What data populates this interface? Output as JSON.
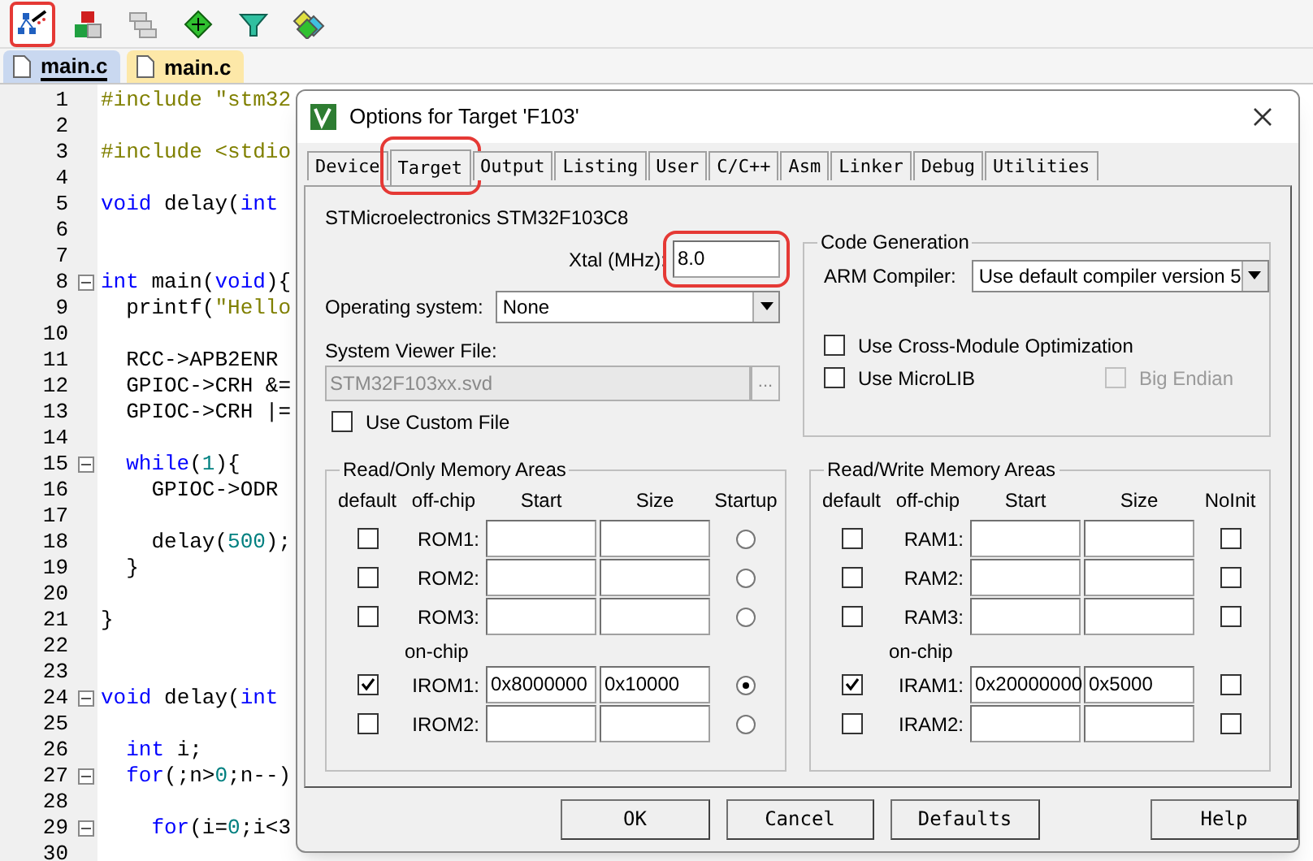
{
  "toolbar": [
    {
      "kind": "wand",
      "highlighted": true
    },
    {
      "kind": "blocks",
      "highlighted": false
    },
    {
      "kind": "windows",
      "highlighted": false
    },
    {
      "kind": "diamond",
      "highlighted": false
    },
    {
      "kind": "funnel",
      "highlighted": false
    },
    {
      "kind": "diamonds",
      "highlighted": false
    }
  ],
  "file_tabs": [
    {
      "label": "main.c",
      "selected": true
    },
    {
      "label": "main.c",
      "selected": false
    }
  ],
  "editor_lines": [
    {
      "number": "1",
      "fold": false,
      "tokens": [
        {
          "text": "#include \"stm32",
          "kind": "pre"
        }
      ]
    },
    {
      "number": "2",
      "fold": false
    },
    {
      "number": "3",
      "fold": false,
      "tokens": [
        {
          "text": "#include <stdio",
          "kind": "pre"
        }
      ]
    },
    {
      "number": "4",
      "fold": false
    },
    {
      "number": "5",
      "fold": false,
      "tokens": [
        {
          "text": "void",
          "kind": "kw"
        },
        {
          "text": " delay(",
          "kind": "plain"
        },
        {
          "text": "int",
          "kind": "kw"
        }
      ]
    },
    {
      "number": "6",
      "fold": false
    },
    {
      "number": "7",
      "fold": false
    },
    {
      "number": "8",
      "fold": true,
      "tokens": [
        {
          "text": "int",
          "kind": "kw"
        },
        {
          "text": " main(",
          "kind": "plain"
        },
        {
          "text": "void",
          "kind": "kw"
        },
        {
          "text": "){",
          "kind": "plain"
        }
      ]
    },
    {
      "number": "9",
      "fold": false,
      "tokens": [
        {
          "text": "  printf(",
          "kind": "plain"
        },
        {
          "text": "\"Hello",
          "kind": "str"
        }
      ]
    },
    {
      "number": "10",
      "fold": false
    },
    {
      "number": "11",
      "fold": false,
      "tokens": [
        {
          "text": "  RCC->APB2ENR",
          "kind": "plain"
        }
      ]
    },
    {
      "number": "12",
      "fold": false,
      "tokens": [
        {
          "text": "  GPIOC->CRH &=",
          "kind": "plain"
        }
      ]
    },
    {
      "number": "13",
      "fold": false,
      "tokens": [
        {
          "text": "  GPIOC->CRH |=",
          "kind": "plain"
        }
      ]
    },
    {
      "number": "14",
      "fold": false
    },
    {
      "number": "15",
      "fold": true,
      "tokens": [
        {
          "text": "  while",
          "kind": "kw"
        },
        {
          "text": "(",
          "kind": "plain"
        },
        {
          "text": "1",
          "kind": "num"
        },
        {
          "text": "){",
          "kind": "plain"
        }
      ]
    },
    {
      "number": "16",
      "fold": false,
      "tokens": [
        {
          "text": "    GPIOC->ODR",
          "kind": "plain"
        }
      ]
    },
    {
      "number": "17",
      "fold": false
    },
    {
      "number": "18",
      "fold": false,
      "tokens": [
        {
          "text": "    delay(",
          "kind": "plain"
        },
        {
          "text": "500",
          "kind": "num"
        },
        {
          "text": ");",
          "kind": "plain"
        }
      ]
    },
    {
      "number": "19",
      "fold": false,
      "tokens": [
        {
          "text": "  }",
          "kind": "plain"
        }
      ]
    },
    {
      "number": "20",
      "fold": false
    },
    {
      "number": "21",
      "fold": false,
      "tokens": [
        {
          "text": "}",
          "kind": "plain"
        }
      ]
    },
    {
      "number": "22",
      "fold": false
    },
    {
      "number": "23",
      "fold": false
    },
    {
      "number": "24",
      "fold": true,
      "tokens": [
        {
          "text": "void",
          "kind": "kw"
        },
        {
          "text": " delay(",
          "kind": "plain"
        },
        {
          "text": "int",
          "kind": "kw"
        }
      ]
    },
    {
      "number": "25",
      "fold": false
    },
    {
      "number": "26",
      "fold": false,
      "tokens": [
        {
          "text": "  int",
          "kind": "kw"
        },
        {
          "text": " i;",
          "kind": "plain"
        }
      ]
    },
    {
      "number": "27",
      "fold": true,
      "tokens": [
        {
          "text": "  for",
          "kind": "kw"
        },
        {
          "text": "(;n>",
          "kind": "plain"
        },
        {
          "text": "0",
          "kind": "num"
        },
        {
          "text": ";n--)",
          "kind": "plain"
        }
      ]
    },
    {
      "number": "28",
      "fold": false
    },
    {
      "number": "29",
      "fold": true,
      "tokens": [
        {
          "text": "    for",
          "kind": "kw"
        },
        {
          "text": "(i=",
          "kind": "plain"
        },
        {
          "text": "0",
          "kind": "num"
        },
        {
          "text": ";i<3",
          "kind": "plain"
        }
      ]
    },
    {
      "number": "30",
      "fold": false
    }
  ],
  "dialog": {
    "title": "Options for Target 'F103'",
    "tabs": [
      {
        "label": "Device",
        "selected": false,
        "highlighted": false
      },
      {
        "label": "Target",
        "selected": true,
        "highlighted": true
      },
      {
        "label": "Output",
        "selected": false,
        "highlighted": false
      },
      {
        "label": "Listing",
        "selected": false,
        "highlighted": false
      },
      {
        "label": "User",
        "selected": false,
        "highlighted": false
      },
      {
        "label": "C/C++",
        "selected": false,
        "highlighted": false
      },
      {
        "label": "Asm",
        "selected": false,
        "highlighted": false
      },
      {
        "label": "Linker",
        "selected": false,
        "highlighted": false
      },
      {
        "label": "Debug",
        "selected": false,
        "highlighted": false
      },
      {
        "label": "Utilities",
        "selected": false,
        "highlighted": false
      }
    ],
    "device": "STMicroelectronics STM32F103C8",
    "xtal": {
      "label": "Xtal (MHz):",
      "value": "8.0",
      "highlighted": true
    },
    "operating_system": {
      "label": "Operating system:",
      "value": "None"
    },
    "system_viewer": {
      "label": "System Viewer File:",
      "value": "STM32F103xx.svd",
      "disabled": true,
      "browse": "..."
    },
    "use_custom_file": {
      "label": "Use Custom File",
      "checked": false
    },
    "code_generation": {
      "title": "Code Generation",
      "compiler_label": "ARM Compiler:",
      "compiler_value": "Use default compiler version 5",
      "options": [
        {
          "label": "Use Cross-Module Optimization",
          "checked": false,
          "disabled": false
        },
        {
          "label": "Use MicroLIB",
          "checked": false,
          "disabled": false
        },
        {
          "label": "Big Endian",
          "checked": false,
          "disabled": true
        }
      ]
    },
    "rom": {
      "title": "Read/Only Memory Areas",
      "columns": [
        "default",
        "off-chip",
        "Start",
        "Size",
        "Startup"
      ],
      "on_chip_label": "on-chip",
      "rows": [
        {
          "name": "ROM1:",
          "default": false,
          "selected": false
        },
        {
          "name": "ROM2:",
          "default": false,
          "selected": false
        },
        {
          "name": "ROM3:",
          "default": false,
          "selected": false
        },
        {
          "name": "IROM1:",
          "default": true,
          "start": "0x8000000",
          "size": "0x10000",
          "selected": true
        },
        {
          "name": "IROM2:",
          "default": false,
          "selected": false
        }
      ]
    },
    "ram": {
      "title": "Read/Write Memory Areas",
      "columns": [
        "default",
        "off-chip",
        "Start",
        "Size",
        "NoInit"
      ],
      "on_chip_label": "on-chip",
      "rows": [
        {
          "name": "RAM1:",
          "default": false,
          "noinit": false
        },
        {
          "name": "RAM2:",
          "default": false,
          "noinit": false
        },
        {
          "name": "RAM3:",
          "default": false,
          "noinit": false
        },
        {
          "name": "IRAM1:",
          "default": true,
          "start": "0x20000000",
          "size": "0x5000",
          "noinit": false
        },
        {
          "name": "IRAM2:",
          "default": false,
          "noinit": false
        }
      ]
    },
    "buttons": [
      "OK",
      "Cancel",
      "Defaults",
      "Help"
    ]
  }
}
